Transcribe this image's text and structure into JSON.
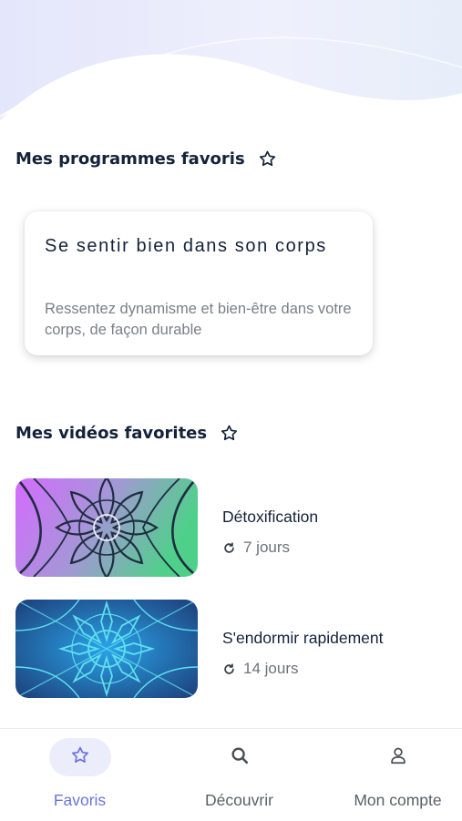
{
  "favorite_programs": {
    "heading": "Mes programmes favoris",
    "heading_icon": "star-outline-icon",
    "cards": [
      {
        "title": "Se sentir bien dans son corps",
        "description": "Ressentez dynamisme et bien-être dans votre corps, de façon durable"
      }
    ]
  },
  "favorite_videos": {
    "heading": "Mes vidéos favorites",
    "heading_icon": "star-outline-icon",
    "items": [
      {
        "title": "Détoxification",
        "duration": "7 jours",
        "duration_icon": "repeat-icon",
        "thumb_colors": [
          "#d56bff",
          "#4fd08a"
        ]
      },
      {
        "title": "S'endormir rapidement",
        "duration": "14 jours",
        "duration_icon": "repeat-icon",
        "thumb_colors": [
          "#1f8fdc",
          "#1d3f7a"
        ]
      }
    ]
  },
  "tab_bar": {
    "tabs": [
      {
        "label": "Favoris",
        "icon": "star-icon",
        "active": true
      },
      {
        "label": "Découvrir",
        "icon": "search-icon",
        "active": false
      },
      {
        "label": "Mon compte",
        "icon": "user-icon",
        "active": false
      }
    ],
    "active_color": "#6c74d9",
    "inactive_color": "#5b6067"
  },
  "colors": {
    "heading": "#14223a",
    "muted_text": "#7a7f87",
    "wave": "#e6e8fb"
  }
}
